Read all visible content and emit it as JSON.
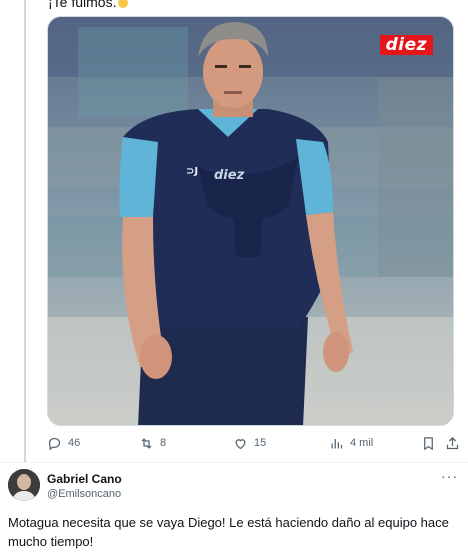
{
  "previous_tweet": {
    "text_tail": "¡Te fuimos."
  },
  "media": {
    "brand_logo": "diez",
    "shirt_brand": "diez",
    "alt": "photo"
  },
  "actions": {
    "reply": {
      "count": "46",
      "icon": "reply-icon"
    },
    "retweet": {
      "count": "8",
      "icon": "retweet-icon"
    },
    "like": {
      "count": "15",
      "icon": "heart-icon"
    },
    "views": {
      "count": "4 mil",
      "icon": "views-icon"
    },
    "bookmark": {
      "icon": "bookmark-icon"
    },
    "share": {
      "icon": "share-icon"
    }
  },
  "reply_tweet": {
    "name": "Gabriel Cano",
    "handle": "@Emilsoncano",
    "more": "···",
    "text": "Motagua necesita que se vaya Diego! Le está haciendo daño al equipo hace mucho tiempo!"
  },
  "colors": {
    "muted": "#536471",
    "border": "#cfd9de",
    "brand_red": "#e3161b"
  }
}
